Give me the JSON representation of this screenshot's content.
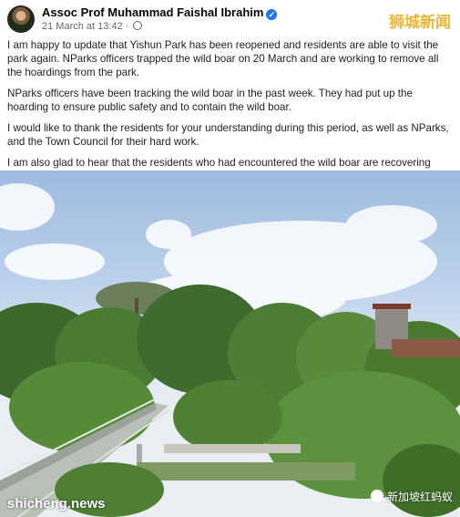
{
  "post": {
    "author": "Assoc Prof Muhammad Faishal Ibrahim",
    "timestamp": "21 March at 13:42 ·",
    "verified_icon": "verified-badge-icon",
    "privacy_icon": "globe-icon",
    "paragraphs": [
      "I am happy to update that Yishun Park has been reopened and residents are able to visit the park again. NParks officers trapped the wild boar on 20 March and are working to remove all the hoardings from the park.",
      "NParks officers have been tracking the wild boar in the past week. They had put up the hoarding to ensure public safety and to contain the wild boar.",
      "I would like to thank the residents for your understanding during this period, as well as NParks, and the Town Council for their hard work.",
      "I am also glad to hear that the residents who had encountered the wild boar are recovering well."
    ]
  },
  "watermarks": {
    "top_right": "狮城新闻",
    "bottom_left": "shicheng.news",
    "bottom_right": "新加坡红蚂蚁"
  },
  "colors": {
    "verified": "#1877f2",
    "watermark_top": "#f2b632"
  }
}
